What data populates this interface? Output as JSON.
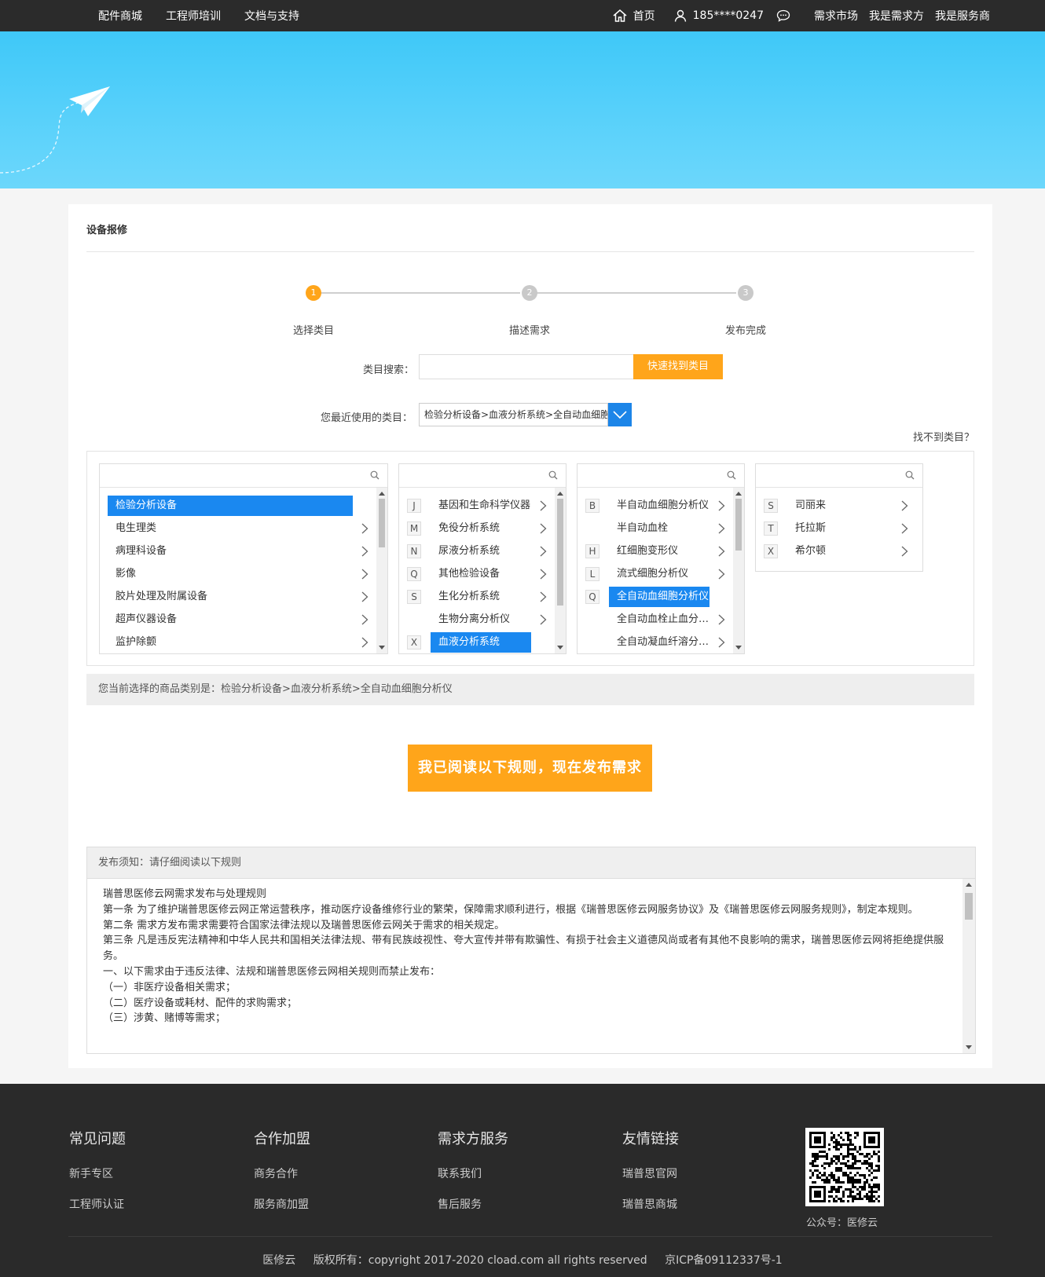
{
  "topbar": {
    "nav_left": [
      "配件商城",
      "工程师培训",
      "文档与支持"
    ],
    "home": "首页",
    "phone": "185****0247",
    "nav_right": [
      "需求市场",
      "我是需求方",
      "我是服务商"
    ]
  },
  "card": {
    "title": "设备报修",
    "steps": [
      {
        "num": "1",
        "label": "选择类目"
      },
      {
        "num": "2",
        "label": "描述需求"
      },
      {
        "num": "3",
        "label": "发布完成"
      }
    ],
    "search_label": "类目搜索：",
    "search_value": "",
    "search_button": "快速找到类目",
    "recent_label": "您最近使用的类目：",
    "recent_value": "检验分析设备>血液分析系统>全自动血细胞分析仪",
    "not_found": "找不到类目？",
    "current_category": "您当前选择的商品类别是：检验分析设备>血液分析系统>全自动血细胞分析仪",
    "publish_button": "我已阅读以下规则，现在发布需求"
  },
  "columns": [
    {
      "items": [
        {
          "letter": "",
          "name": "检验分析设备",
          "selected": true,
          "chev": false
        },
        {
          "letter": "",
          "name": "电生理类",
          "selected": false,
          "chev": true
        },
        {
          "letter": "",
          "name": "病理科设备",
          "selected": false,
          "chev": true
        },
        {
          "letter": "",
          "name": "影像",
          "selected": false,
          "chev": true
        },
        {
          "letter": "",
          "name": "胶片处理及附属设备",
          "selected": false,
          "chev": true
        },
        {
          "letter": "",
          "name": "超声仪器设备",
          "selected": false,
          "chev": true
        },
        {
          "letter": "",
          "name": "监护除颤",
          "selected": false,
          "chev": true
        }
      ]
    },
    {
      "items": [
        {
          "letter": "J",
          "name": "基因和生命科学仪器",
          "selected": false,
          "chev": true
        },
        {
          "letter": "M",
          "name": "免役分析系统",
          "selected": false,
          "chev": true
        },
        {
          "letter": "N",
          "name": "尿液分析系统",
          "selected": false,
          "chev": true
        },
        {
          "letter": "Q",
          "name": "其他检验设备",
          "selected": false,
          "chev": true
        },
        {
          "letter": "S",
          "name": "生化分析系统",
          "selected": false,
          "chev": true
        },
        {
          "letter": "",
          "name": "生物分离分析仪",
          "selected": false,
          "chev": true
        },
        {
          "letter": "X",
          "name": "血液分析系统",
          "selected": true,
          "chev": false
        }
      ]
    },
    {
      "items": [
        {
          "letter": "B",
          "name": "半自动血细胞分析仪",
          "selected": false,
          "chev": true
        },
        {
          "letter": "",
          "name": "半自动血栓",
          "selected": false,
          "chev": true
        },
        {
          "letter": "H",
          "name": "红细胞变形仪",
          "selected": false,
          "chev": true
        },
        {
          "letter": "L",
          "name": "流式细胞分析仪",
          "selected": false,
          "chev": true
        },
        {
          "letter": "Q",
          "name": "全自动血细胞分析仪",
          "selected": true,
          "chev": false
        },
        {
          "letter": "",
          "name": "全自动血栓止血分…",
          "selected": false,
          "chev": true
        },
        {
          "letter": "",
          "name": "全自动凝血纤溶分…",
          "selected": false,
          "chev": true
        }
      ]
    },
    {
      "items": [
        {
          "letter": "S",
          "name": "司丽来",
          "selected": false,
          "chev": true
        },
        {
          "letter": "T",
          "name": "托拉斯",
          "selected": false,
          "chev": true
        },
        {
          "letter": "X",
          "name": "希尔顿",
          "selected": false,
          "chev": true
        }
      ]
    }
  ],
  "notice": {
    "title": "发布须知：请仔细阅读以下规则",
    "lines": [
      "瑞普思医修云网需求发布与处理规则",
      "第一条 为了维护瑞普思医修云网正常运营秩序，推动医疗设备维修行业的繁荣，保障需求顺利进行，根据《瑞普思医修云网服务协议》及《瑞普思医修云网服务规则》，制定本规则。",
      "第二条 需求方发布需求需要符合国家法律法规以及瑞普思医修云网关于需求的相关规定。",
      "第三条 凡是违反宪法精神和中华人民共和国相关法律法规、带有民族歧视性、夸大宣传并带有欺骗性、有损于社会主义道德风尚或者有其他不良影响的需求，瑞普思医修云网将拒绝提供服务。",
      "一、以下需求由于违反法律、法规和瑞普思医修云网相关规则而禁止发布：",
      "（一）非医疗设备相关需求；",
      "（二）医疗设备或耗材、配件的求购需求；",
      "（三）涉黄、赌博等需求；"
    ]
  },
  "footer": {
    "columns": [
      {
        "title": "常见问题",
        "links": [
          "新手专区",
          "工程师认证"
        ]
      },
      {
        "title": "合作加盟",
        "links": [
          "商务合作",
          "服务商加盟"
        ]
      },
      {
        "title": "需求方服务",
        "links": [
          "联系我们",
          "售后服务"
        ]
      },
      {
        "title": "友情链接",
        "links": [
          "瑞普思官网",
          "瑞普思商城"
        ]
      }
    ],
    "qr_caption": "公众号：医修云",
    "copyright": [
      "医修云",
      "版权所有：copyright 2017-2020 cload.com all rights reserved",
      "京ICP备09112337号-1"
    ]
  },
  "colors": {
    "accent": "#ffa51a",
    "selected": "#1a88f0",
    "topbar": "#2b2b2b",
    "banner": "#3fc8f8"
  }
}
